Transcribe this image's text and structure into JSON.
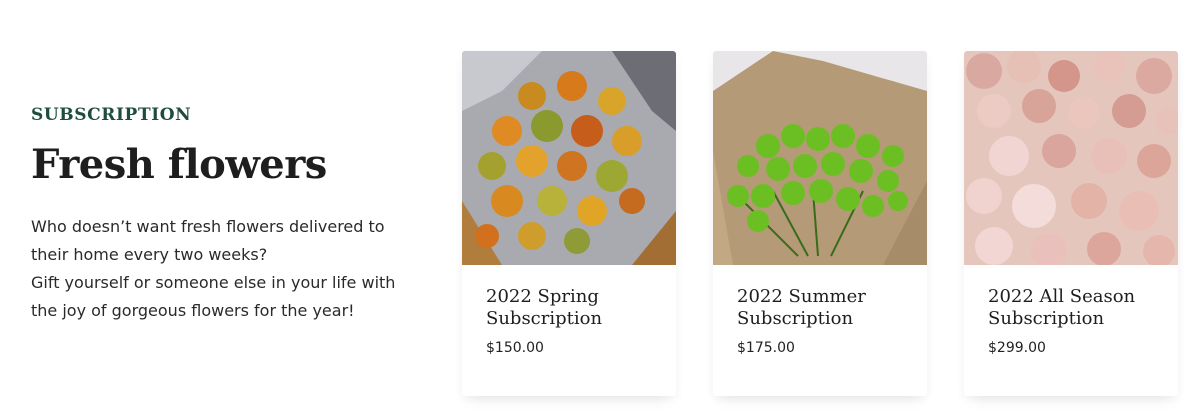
{
  "section": {
    "eyebrow": "SUBSCRIPTION",
    "headline": "Fresh flowers",
    "description_lines": [
      "Who doesn’t want fresh flowers delivered to",
      "their home every two weeks?",
      "Gift yourself or someone else in your life with",
      "the joy of gorgeous flowers for the year!"
    ]
  },
  "products": [
    {
      "title_lines": [
        "2022 Spring",
        "Subscription"
      ],
      "price": "$150.00"
    },
    {
      "title_lines": [
        "2022 Summer",
        "Subscription"
      ],
      "price": "$175.00"
    },
    {
      "title_lines": [
        "2022 All Season",
        "Subscription"
      ],
      "price": "$299.00"
    }
  ]
}
